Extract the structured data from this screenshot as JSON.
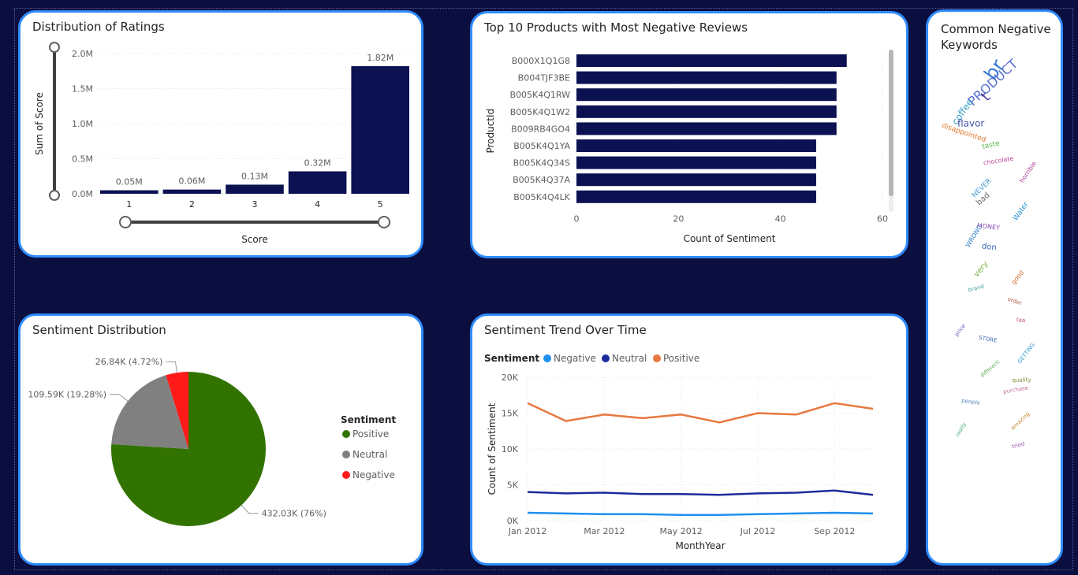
{
  "ratings": {
    "title": "Distribution of Ratings",
    "chart_data": {
      "type": "bar",
      "title": "Distribution of Ratings",
      "xlabel": "Score",
      "ylabel": "Sum of Score",
      "categories": [
        "1",
        "2",
        "3",
        "4",
        "5"
      ],
      "values": [
        0.05,
        0.06,
        0.13,
        0.32,
        1.82
      ],
      "data_labels": [
        "0.05M",
        "0.06M",
        "0.13M",
        "0.32M",
        "1.82M"
      ],
      "y_ticks": [
        "0.0M",
        "0.5M",
        "1.0M",
        "1.5M",
        "2.0M"
      ],
      "ylim": [
        0,
        2.0
      ],
      "grid": true,
      "bar_color": "#0c1152"
    }
  },
  "neg_products": {
    "title": "Top 10 Products with Most Negative Reviews",
    "chart_data": {
      "type": "bar",
      "orientation": "horizontal",
      "title": "Top 10 Products with Most Negative Reviews",
      "xlabel": "Count of Sentiment",
      "ylabel": "ProductId",
      "categories": [
        "B000X1Q1G8",
        "B004TJF3BE",
        "B005K4Q1RW",
        "B005K4Q1W2",
        "B009RB4GO4",
        "B005K4Q1YA",
        "B005K4Q34S",
        "B005K4Q37A",
        "B005K4Q4LK"
      ],
      "values": [
        53,
        51,
        51,
        51,
        51,
        47,
        47,
        47,
        47
      ],
      "x_ticks": [
        "0",
        "20",
        "40",
        "60"
      ],
      "xlim": [
        0,
        60
      ],
      "grid": true,
      "bar_color": "#0c1152"
    }
  },
  "keywords": {
    "title": "Common Negative Keywords",
    "words": [
      {
        "text": "br",
        "color": "#3a7bd5",
        "size": 24
      },
      {
        "text": "PRODUCT",
        "color": "#5a6fd0",
        "size": 16
      },
      {
        "text": "t",
        "color": "#4b3fa0",
        "size": 18
      },
      {
        "text": "coffee",
        "color": "#3aa0c8",
        "size": 12
      },
      {
        "text": "flavor",
        "color": "#3b4fa8",
        "size": 12
      },
      {
        "text": "disappointed",
        "color": "#e07b30",
        "size": 9
      },
      {
        "text": "taste",
        "color": "#5ab84a",
        "size": 9
      },
      {
        "text": "chocolate",
        "color": "#c64aa0",
        "size": 8
      },
      {
        "text": "horrible",
        "color": "#b0409a",
        "size": 8
      },
      {
        "text": "NEVER",
        "color": "#4a9ad0",
        "size": 9
      },
      {
        "text": "bad",
        "color": "#6a6a6a",
        "size": 10
      },
      {
        "text": "Water",
        "color": "#2a8fd0",
        "size": 9
      },
      {
        "text": "MONEY",
        "color": "#8a4ab0",
        "size": 8
      },
      {
        "text": "WRONG",
        "color": "#3080c8",
        "size": 8
      },
      {
        "text": "don",
        "color": "#2f5fb8",
        "size": 10
      },
      {
        "text": "very",
        "color": "#7bb040",
        "size": 10
      },
      {
        "text": "good",
        "color": "#d06a30",
        "size": 8
      },
      {
        "text": "brand",
        "color": "#4aa0a0",
        "size": 7
      },
      {
        "text": "order",
        "color": "#b05a3a",
        "size": 7
      },
      {
        "text": "tea",
        "color": "#c84a60",
        "size": 7
      },
      {
        "text": "price",
        "color": "#7a5ac0",
        "size": 7
      },
      {
        "text": "STORE",
        "color": "#3a6ab0",
        "size": 7
      },
      {
        "text": "GETTING",
        "color": "#3aa0d0",
        "size": 7
      },
      {
        "text": "different",
        "color": "#6ab060",
        "size": 7
      },
      {
        "text": "quality",
        "color": "#8a8a3a",
        "size": 7
      },
      {
        "text": "purchase",
        "color": "#c06a9a",
        "size": 7
      },
      {
        "text": "people",
        "color": "#5a8ac0",
        "size": 7
      },
      {
        "text": "amazing",
        "color": "#c0903a",
        "size": 7
      },
      {
        "text": "really",
        "color": "#4ab080",
        "size": 7
      },
      {
        "text": "tried",
        "color": "#9a5ab0",
        "size": 7
      }
    ]
  },
  "sentiment_dist": {
    "title": "Sentiment Distribution",
    "legend_title": "Sentiment",
    "chart_data": {
      "type": "pie",
      "title": "Sentiment Distribution",
      "legend": [
        "Positive",
        "Neutral",
        "Negative"
      ],
      "legend_placement": "right",
      "slices": [
        {
          "name": "Positive",
          "value": 432.03,
          "percent": 76,
          "label": "432.03K (76%)",
          "color": "#327300"
        },
        {
          "name": "Neutral",
          "value": 109.59,
          "percent": 19.28,
          "label": "109.59K (19.28%)",
          "color": "#808080"
        },
        {
          "name": "Negative",
          "value": 26.84,
          "percent": 4.72,
          "label": "26.84K (4.72%)",
          "color": "#ff1a1a"
        }
      ]
    }
  },
  "trend": {
    "title": "Sentiment Trend Over Time",
    "legend_title": "Sentiment",
    "chart_data": {
      "type": "line",
      "title": "Sentiment Trend Over Time",
      "xlabel": "MonthYear",
      "ylabel": "Count of Sentiment",
      "x": [
        "Jan 2012",
        "Feb 2012",
        "Mar 2012",
        "Apr 2012",
        "May 2012",
        "Jun 2012",
        "Jul 2012",
        "Aug 2012",
        "Sep 2012",
        "Oct 2012"
      ],
      "x_tick_labels": [
        "Jan 2012",
        "Mar 2012",
        "May 2012",
        "Jul 2012",
        "Sep 2012"
      ],
      "y_ticks": [
        "0K",
        "5K",
        "10K",
        "15K",
        "20K"
      ],
      "ylim": [
        0,
        20
      ],
      "y_unit": "K",
      "grid": true,
      "legend_placement": "top-left",
      "series": [
        {
          "name": "Negative",
          "color": "#1f8ff0",
          "values": [
            1.1,
            1.0,
            0.9,
            0.9,
            0.8,
            0.8,
            0.9,
            1.0,
            1.1,
            1.0
          ]
        },
        {
          "name": "Neutral",
          "color": "#1d2b9a",
          "values": [
            4.0,
            3.8,
            3.9,
            3.7,
            3.7,
            3.6,
            3.8,
            3.9,
            4.2,
            3.6
          ]
        },
        {
          "name": "Positive",
          "color": "#e8773f",
          "values": [
            16.4,
            13.9,
            14.8,
            14.3,
            14.8,
            13.7,
            15.0,
            14.8,
            16.4,
            15.6
          ]
        }
      ]
    }
  }
}
